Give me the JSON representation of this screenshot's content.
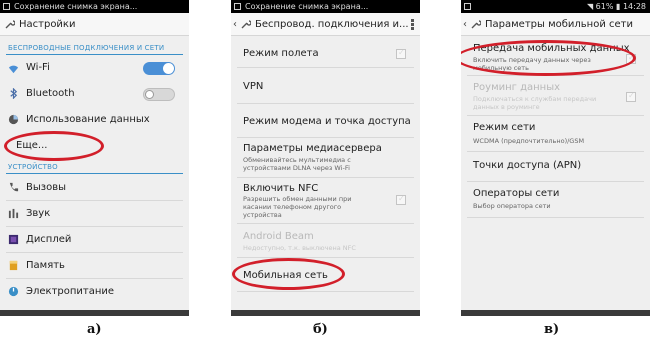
{
  "accent_color": "#3a8fc7",
  "highlight_color": "#d21f2a",
  "panel_a": {
    "status_text": "Сохранение снимка экрана...",
    "title": "Настройки",
    "section_wireless": "БЕСПРОВОДНЫЕ ПОДКЛЮЧЕНИЯ И СЕТИ",
    "wifi_label": "Wi-Fi",
    "wifi_state": "on",
    "bluetooth_label": "Bluetooth",
    "bluetooth_state": "off",
    "data_usage_label": "Использование данных",
    "more_label": "Еще...",
    "section_device": "УСТРОЙСТВО",
    "calls_label": "Вызовы",
    "sound_label": "Звук",
    "display_label": "Дисплей",
    "storage_label": "Память",
    "power_label": "Электропитание",
    "caption": "а)"
  },
  "panel_b": {
    "status_text": "Сохранение снимка экрана...",
    "title": "Беспровод. подключения и...",
    "airplane_label": "Режим полета",
    "vpn_label": "VPN",
    "tethering_label": "Режим модема и точка доступа",
    "media_server_label": "Параметры медиасервера",
    "media_server_sub": "Обменивайтесь мультимедиа с устройствами DLNA через Wi-Fi",
    "nfc_label": "Включить NFC",
    "nfc_sub": "Разрешить обмен данными при касании телефоном другого устройства",
    "beam_label": "Android Beam",
    "beam_sub": "Недоступно, т.к. выключена NFC",
    "mobile_network_label": "Мобильная сеть",
    "caption": "б)"
  },
  "panel_c": {
    "status_time": "14:28",
    "battery": "61%",
    "title": "Параметры мобильной сети",
    "mobile_data_label": "Передача мобильных данных",
    "mobile_data_sub": "Включить передачу данных через мобильную сеть",
    "roaming_label": "Роуминг данных",
    "roaming_sub": "Подключаться к службам передачи данных в роуминге",
    "network_mode_label": "Режим сети",
    "network_mode_sub": "WCDMA (предпочтительно)/GSM",
    "apn_label": "Точки доступа (APN)",
    "operators_label": "Операторы сети",
    "operators_sub": "Выбор оператора сети",
    "caption": "в)"
  }
}
